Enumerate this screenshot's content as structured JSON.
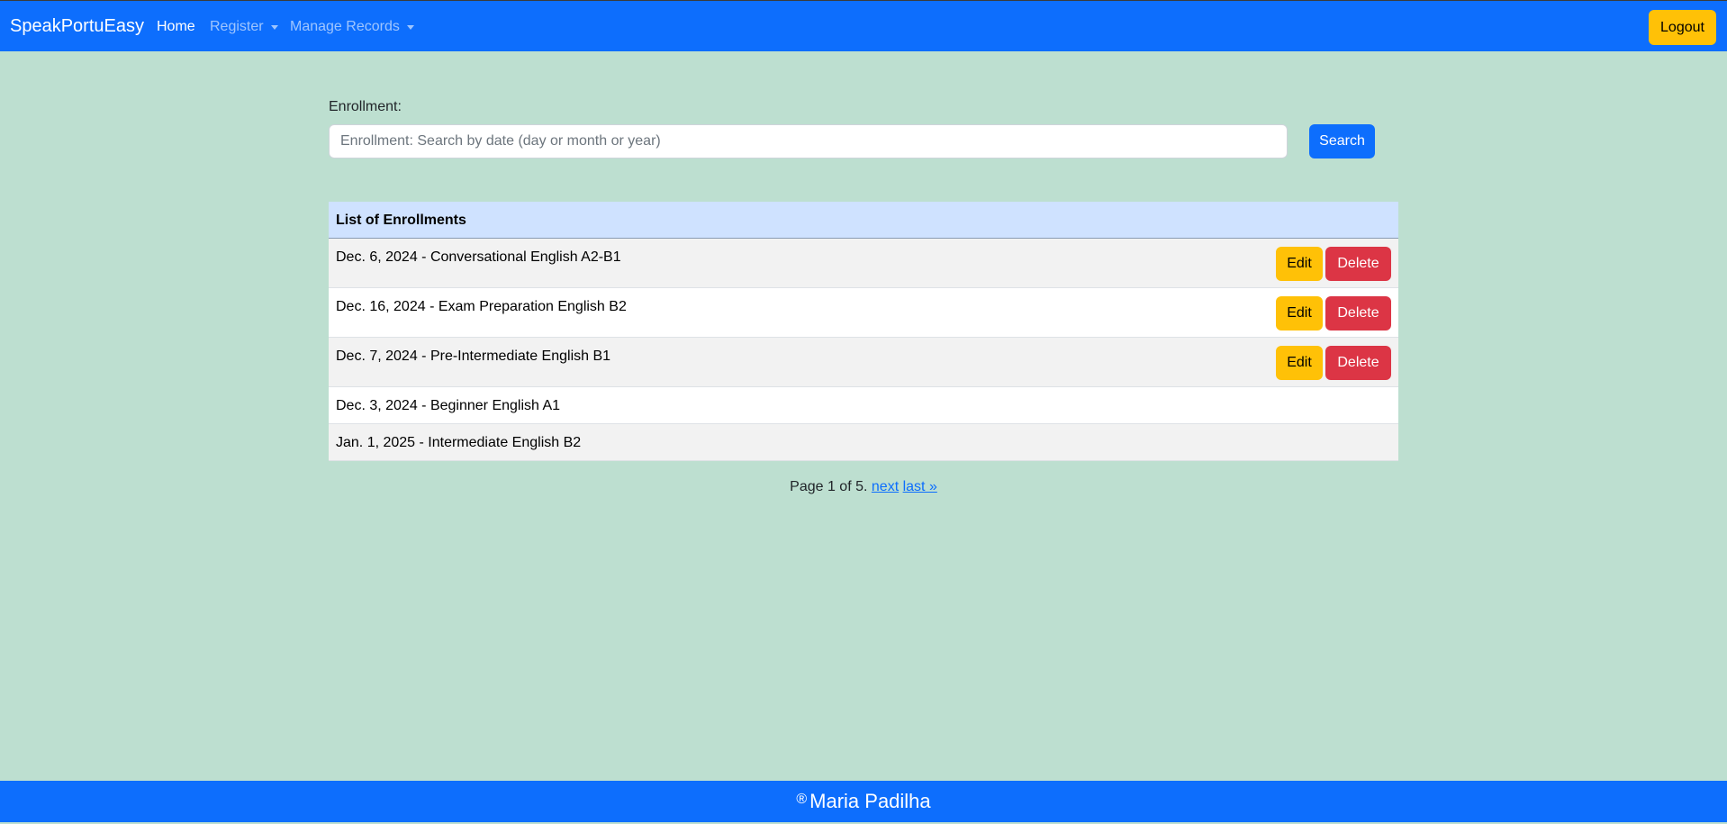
{
  "navbar": {
    "brand": "SpeakPortuEasy",
    "items": [
      {
        "label": "Home"
      },
      {
        "label": "Register"
      },
      {
        "label": "Manage Records"
      }
    ],
    "logout_label": "Logout"
  },
  "search": {
    "label": "Enrollment:",
    "placeholder": "Enrollment: Search by date (day or month or year)",
    "value": "",
    "button_label": "Search"
  },
  "table": {
    "header": "List of Enrollments",
    "edit_label": "Edit",
    "delete_label": "Delete",
    "rows": [
      {
        "text": "Dec. 6, 2024 - Conversational English A2-B1"
      },
      {
        "text": "Dec. 16, 2024 - Exam Preparation English B2"
      },
      {
        "text": "Dec. 7, 2024 - Pre-Intermediate English B1"
      },
      {
        "text": "Dec. 3, 2024 - Beginner English A1"
      },
      {
        "text": "Jan. 1, 2025 - Intermediate English B2"
      }
    ]
  },
  "pagination": {
    "status": "Page 1 of 5.",
    "next": "next",
    "last": "last »"
  },
  "footer": {
    "symbol": "®",
    "text": "Maria Padilha"
  },
  "colors": {
    "primary": "#0d6efd",
    "warning": "#ffc107",
    "danger": "#dc3545",
    "background": "#bddfd0",
    "table_header": "#cfe2ff"
  }
}
